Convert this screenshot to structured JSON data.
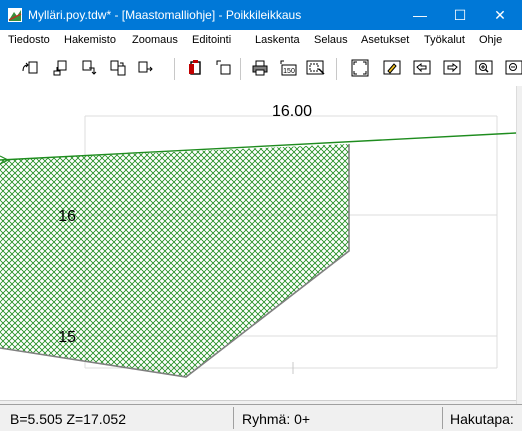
{
  "window": {
    "title": "Mylläri.poy.tdw* - [Maastomalliohje] - Poikkileikkaus",
    "minimize_glyph": "—",
    "maximize_glyph": "☐",
    "close_glyph": "✕"
  },
  "menu": [
    "Tiedosto",
    "Hakemisto",
    "Zoomaus",
    "Editointi",
    "Laskenta",
    "Selaus",
    "Asetukset",
    "Työkalut",
    "Ohje"
  ],
  "toolbar": {
    "icons": [
      "new-left-icon",
      "new-up-icon",
      "new-down-icon",
      "copy-section-icon",
      "next-section-icon",
      "paste-icon",
      "copy-window-icon",
      "print-icon",
      "scale-150-icon",
      "print-preview-icon",
      "zoom-fit-icon",
      "edit-icon",
      "back-icon",
      "forward-icon",
      "zoom-in-icon",
      "zoom-out-icon"
    ],
    "scale_label": "150"
  },
  "plot": {
    "top_label": "16.00",
    "y_labels": [
      "16",
      "15"
    ],
    "ground_line_color": "#1e8c1e",
    "hatch_color": "#1e8c1e"
  },
  "status": {
    "coords": "B=5.505  Z=17.052",
    "group": "Ryhmä: 0+",
    "search": "Hakutapa:"
  }
}
